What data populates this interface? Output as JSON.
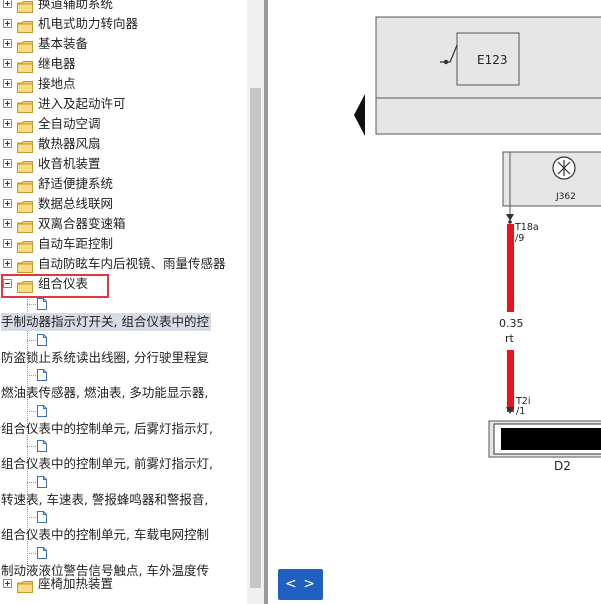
{
  "tree": {
    "folders_top": [
      "换道辅助系统",
      "机电式助力转向器",
      "基本装备",
      "继电器",
      "接地点",
      "进入及起动许可",
      "全自动空调",
      "散热器风扇",
      "收音机装置",
      "舒适便捷系统",
      "数据总线联网",
      "双离合器变速箱",
      "自动车距控制",
      "自动防眩车内后视镜、雨量传感器"
    ],
    "expanded_folder": "组合仪表",
    "leaves": [
      "手制动器指示灯开关, 组合仪表中的控",
      "防盗锁止系统读出线圈, 分行驶里程复",
      "燃油表传感器, 燃油表, 多功能显示器,",
      "组合仪表中的控制单元, 后雾灯指示灯,",
      "组合仪表中的控制单元, 前雾灯指示灯,",
      "转速表, 车速表, 警报蜂鸣器和警报音,",
      "组合仪表中的控制单元, 车载电网控制",
      "制动液液位警告信号触点, 车外温度传"
    ],
    "folders_bottom": [
      "座椅加热装置"
    ]
  },
  "diagram": {
    "component_e": "E123",
    "component_j": "J362",
    "pin_top": "T18a",
    "pin_top_num": "/9",
    "wire_size": "0.35",
    "wire_color_code": "rt",
    "pin_bottom": "T2i",
    "pin_bottom_num": "/1",
    "connector": "D2",
    "colors": {
      "wire": "#e8141b",
      "panel": "#e6e6e6",
      "frame": "#555555"
    }
  },
  "nav": {
    "label": "< >"
  }
}
